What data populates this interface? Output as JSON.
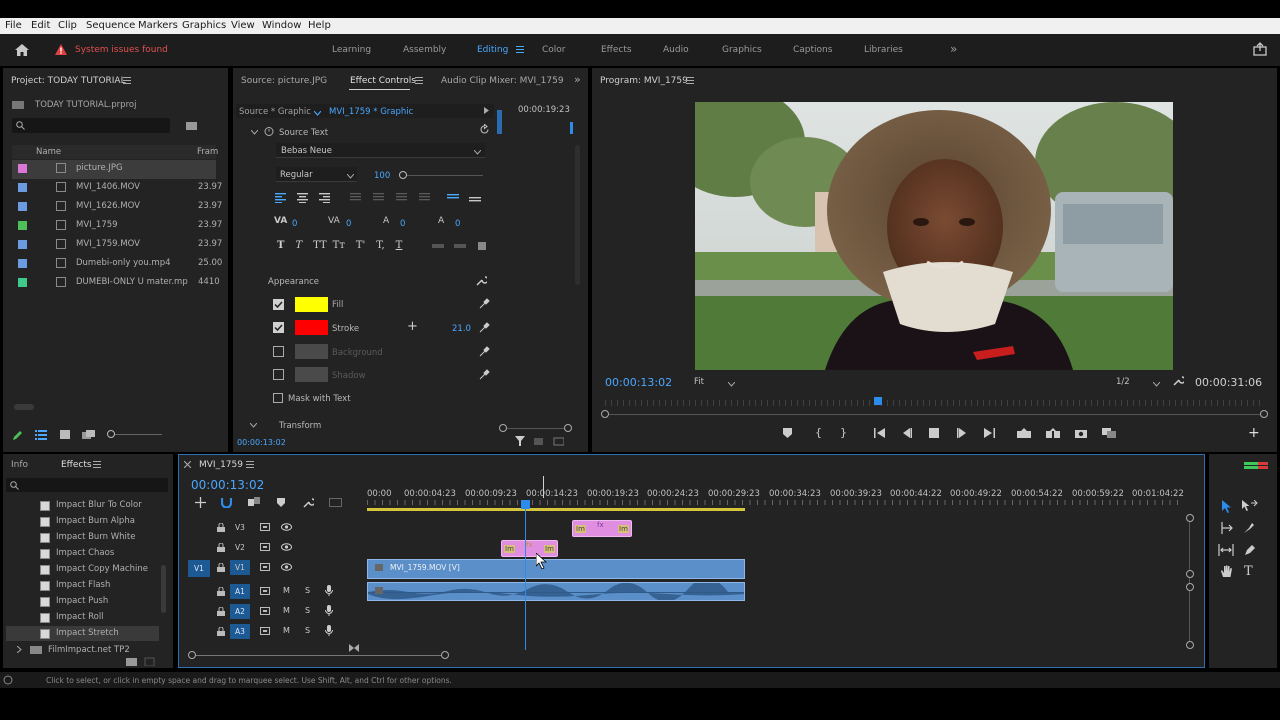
{
  "menu": [
    "File",
    "Edit",
    "Clip",
    "Sequence",
    "Markers",
    "Graphics",
    "View",
    "Window",
    "Help"
  ],
  "header": {
    "warning": "System issues found",
    "workspaces": [
      "Learning",
      "Assembly",
      "Editing",
      "Color",
      "Effects",
      "Audio",
      "Graphics",
      "Captions",
      "Libraries"
    ],
    "active_workspace": "Editing",
    "more": "»"
  },
  "project": {
    "title": "Project: TODAY TUTORIAL",
    "file": "TODAY TUTORIAL.prproj",
    "col_name": "Name",
    "col_frame": "Fram",
    "items": [
      {
        "name": "picture.JPG",
        "frame": "",
        "color": "#d977d6"
      },
      {
        "name": "MVI_1406.MOV",
        "frame": "23.97",
        "color": "#6b9be0"
      },
      {
        "name": "MVI_1626.MOV",
        "frame": "23.97",
        "color": "#6b9be0"
      },
      {
        "name": "MVI_1759",
        "frame": "23.97",
        "color": "#4fbf5a"
      },
      {
        "name": "MVI_1759.MOV",
        "frame": "23.97",
        "color": "#6b9be0"
      },
      {
        "name": "Dumebi-only you.mp4",
        "frame": "25.00",
        "color": "#6b9be0"
      },
      {
        "name": "DUMEBI-ONLY U mater.mp",
        "frame": "4410",
        "color": "#3fc98a"
      }
    ]
  },
  "source_tabs": {
    "source": "Source: picture.JPG",
    "effect_controls": "Effect Controls",
    "audio_mixer": "Audio Clip Mixer: MVI_1759"
  },
  "effect_controls": {
    "source_graphic": "Source * Graphic",
    "seq_graphic": "MVI_1759 * Graphic",
    "timecode": "00:00:19:23",
    "source_text": "Source Text",
    "font": "Bebas Neue",
    "style": "Regular",
    "size": "100",
    "tracking": "0",
    "kerning": "0",
    "leading": "0",
    "baseline": "0",
    "appearance": "Appearance",
    "fill": "Fill",
    "stroke": "Stroke",
    "stroke_width": "21.0",
    "background": "Background",
    "shadow": "Shadow",
    "mask": "Mask with Text",
    "transform": "Transform",
    "current_time": "00:00:13:02",
    "fill_color": "#ffff00",
    "stroke_color": "#ff0000"
  },
  "program": {
    "title": "Program: MVI_1759",
    "timecode": "00:00:13:02",
    "fit": "Fit",
    "resolution": "1/2",
    "duration": "00:00:31:06"
  },
  "effects_panel": {
    "info_tab": "Info",
    "effects_tab": "Effects",
    "items": [
      "Impact Blur To Color",
      "Impact Burn Alpha",
      "Impact Burn White",
      "Impact Chaos",
      "Impact Copy Machine",
      "Impact Flash",
      "Impact Push",
      "Impact Roll",
      "Impact Stretch"
    ],
    "folder": "FilmImpact.net TP2"
  },
  "timeline": {
    "title": "MVI_1759",
    "timecode": "00:00:13:02",
    "ruler": [
      "00:00",
      "00:00:04:23",
      "00:00:09:23",
      "00:00:14:23",
      "00:00:19:23",
      "00:00:24:23",
      "00:00:29:23",
      "00:00:34:23",
      "00:00:39:23",
      "00:00:44:22",
      "00:00:49:22",
      "00:00:54:22",
      "00:00:59:22",
      "00:01:04:22"
    ],
    "video_tracks": [
      "V3",
      "V2",
      "V1"
    ],
    "audio_tracks": [
      "A1",
      "A2",
      "A3"
    ],
    "source_patch": "V1",
    "clip_v1": "MVI_1759.MOV [V]",
    "clip_label": "Im",
    "mute": "M",
    "solo": "S"
  },
  "status_bar": "Click to select, or click in empty space and drag to marquee select. Use Shift, Alt, and Ctrl for other options.",
  "colors": {
    "accent": "#2d8ceb",
    "clip_pink": "#e08fe0",
    "clip_blue": "#5b8fc9"
  }
}
